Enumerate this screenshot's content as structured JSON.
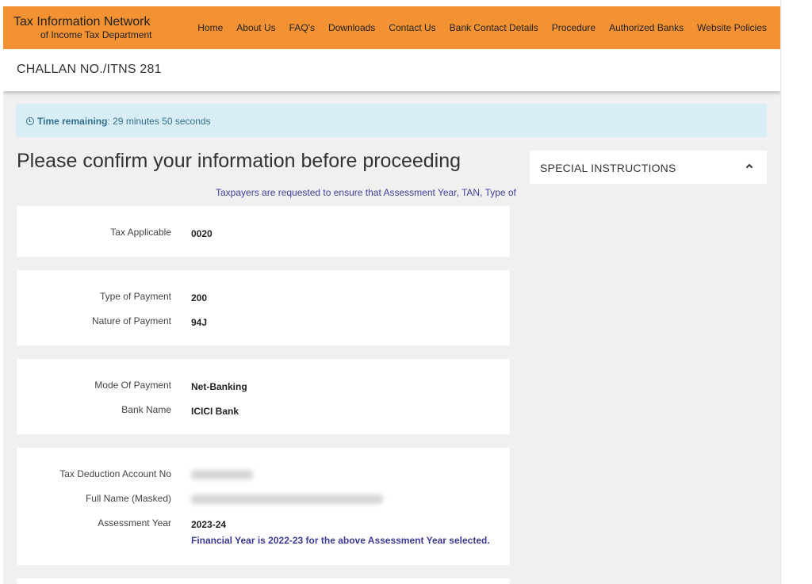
{
  "header": {
    "brand_title": "Tax Information Network",
    "brand_subtitle": "of Income Tax Department",
    "nav": [
      "Home",
      "About Us",
      "FAQ's",
      "Downloads",
      "Contact Us",
      "Bank Contact Details",
      "Procedure",
      "Authorized Banks",
      "Website Policies"
    ]
  },
  "page_title": "CHALLAN NO./ITNS 281",
  "timer": {
    "label": "Time remaining",
    "value": ": 29 minutes 50 seconds"
  },
  "confirm_heading": "Please confirm your information before proceeding",
  "notice": "Taxpayers are requested to ensure that Assessment Year, TAN, Type of",
  "sections": {
    "tax": {
      "tax_applicable_label": "Tax Applicable",
      "tax_applicable_value": "0020"
    },
    "payment": {
      "type_label": "Type of Payment",
      "type_value": "200",
      "nature_label": "Nature of Payment",
      "nature_value": "94J"
    },
    "mode": {
      "mode_label": "Mode Of Payment",
      "mode_value": "Net-Banking",
      "bank_label": "Bank Name",
      "bank_value": "ICICI Bank"
    },
    "account": {
      "tan_label": "Tax Deduction Account No",
      "name_label": "Full Name (Masked)",
      "ay_label": "Assessment Year",
      "ay_value": "2023-24",
      "fy_note": "Financial Year is 2022-23 for the above Assessment Year selected."
    }
  },
  "special_instructions": "SPECIAL INSTRUCTIONS",
  "colors": {
    "header": "#f39232",
    "timer_bg": "#d9edf7",
    "timer_text": "#31708f",
    "notice": "#3f3f9f"
  }
}
